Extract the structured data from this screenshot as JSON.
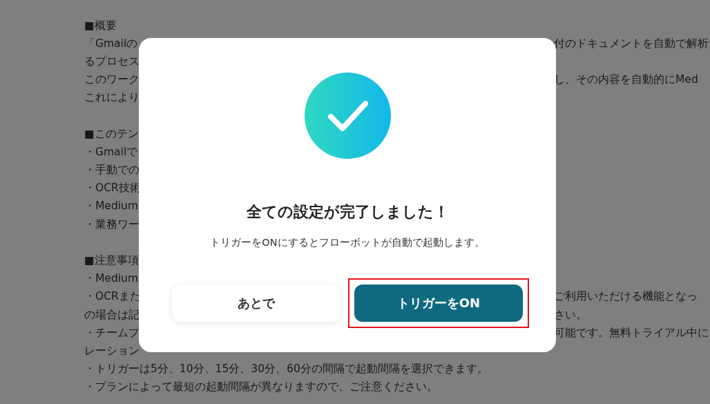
{
  "background": {
    "sections": [
      {
        "lines": [
          {
            "left": "■概要"
          },
          {
            "left": "「Gmailの",
            "right": "付のドキュメントを自動で解析"
          },
          {
            "left": "るプロセス"
          },
          {
            "left": "このワーク",
            "right": "し、その内容を自動的にMed"
          },
          {
            "left": "これにより"
          }
        ]
      },
      {
        "lines": [
          {
            "left": "■このテン"
          },
          {
            "left": "・Gmailで"
          },
          {
            "left": "・手動での"
          },
          {
            "left": "・OCR技術"
          },
          {
            "left": "・Medium"
          },
          {
            "left": "・業務ワー"
          }
        ]
      },
      {
        "lines": [
          {
            "left": "■注意事項"
          },
          {
            "left": "・Medium"
          },
          {
            "left": "・OCRまた",
            "right": "ご利用いただける機能となっ"
          },
          {
            "left": "の場合は記",
            "right": "さい。"
          },
          {
            "left": "・チームプ",
            "right": "可能です。無料トライアル中に"
          },
          {
            "left": "レーション"
          },
          {
            "left": "・トリガーは5分、10分、15分、30分、60分の間隔で起動間隔を選択できます。"
          },
          {
            "left": "・プランによって最短の起動間隔が異なりますので、ご注意ください。"
          }
        ]
      }
    ]
  },
  "dialog": {
    "title": "全ての設定が完了しました！",
    "message": "トリガーをONにするとフローボットが自動で起動します。",
    "buttons": [
      {
        "label": "あとで",
        "kind": "secondary",
        "highlighted": false
      },
      {
        "label": "トリガーをON",
        "kind": "primary",
        "highlighted": true
      }
    ]
  }
}
